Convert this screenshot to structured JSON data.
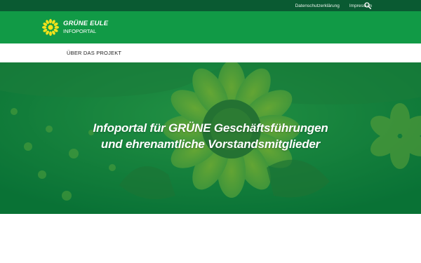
{
  "topbar": {
    "links": [
      "Datenschutzerklärung",
      "Impressum"
    ],
    "search_icon": "search-icon"
  },
  "header": {
    "title": "GRÜNE EULE",
    "subtitle": "INFOPORTAL",
    "logo_icon": "sunflower-icon"
  },
  "nav": {
    "items": [
      "ÜBER DAS PROJEKT"
    ]
  },
  "hero": {
    "line1": "Infoportal für GRÜNE Geschäftsführungen",
    "line2": "und ehrenamtliche Vorstandsmitglieder"
  },
  "colors": {
    "topbar": "#0a5a32",
    "header": "#119a46",
    "hero_tint": "#077d3c"
  }
}
